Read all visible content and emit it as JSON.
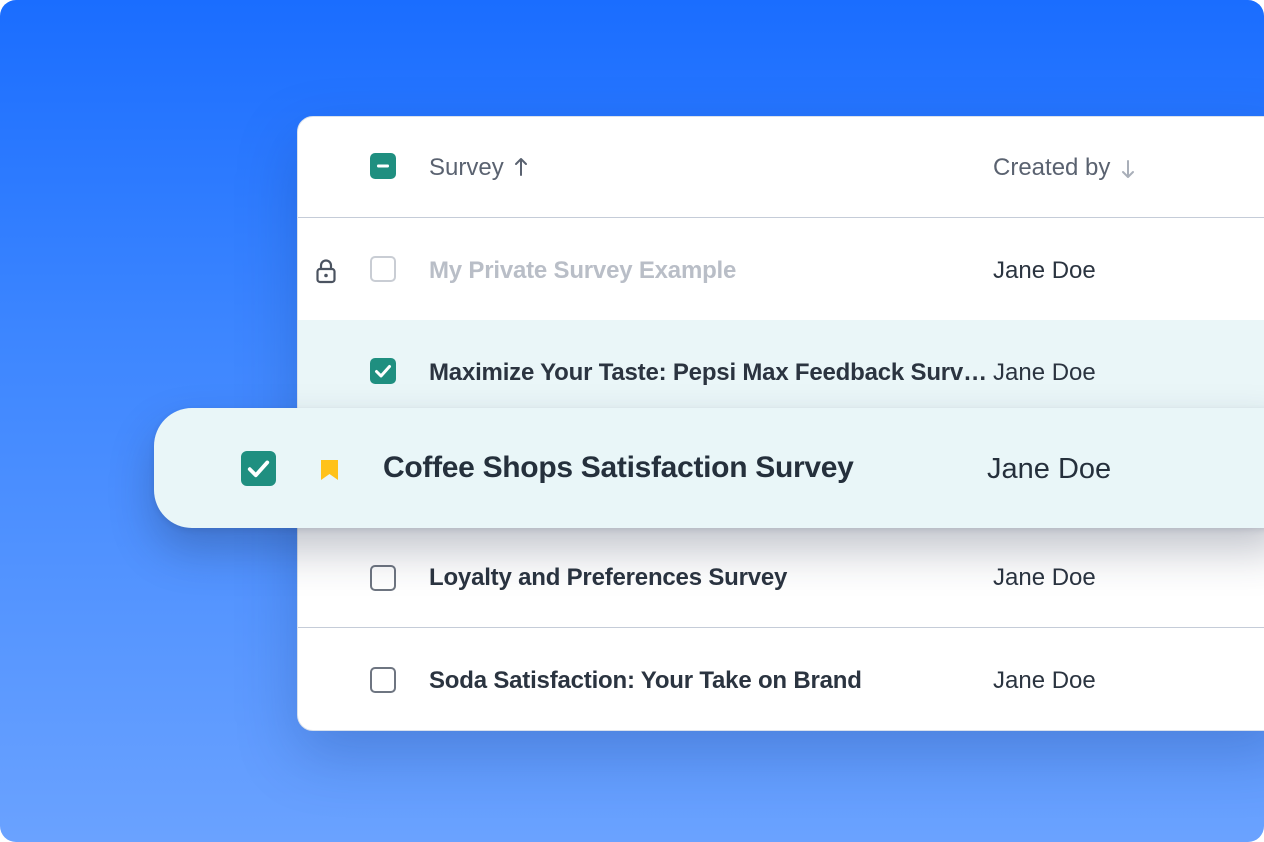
{
  "table": {
    "header": {
      "survey_label": "Survey",
      "survey_sort_icon": "arrow-up-icon",
      "created_by_label": "Created by",
      "created_by_sort_icon": "arrow-down-icon",
      "select_all_state": "indeterminate"
    },
    "rows": [
      {
        "survey": "My Private Survey Example",
        "created_by": "Jane Doe",
        "checked": false,
        "private": true,
        "icon": "lock-icon"
      },
      {
        "survey": "Maximize Your Taste: Pepsi Max Feedback Surv…",
        "created_by": "Jane Doe",
        "checked": true,
        "private": false
      },
      {
        "survey": "Coffee Shops Satisfaction Survey",
        "created_by": "Jane Doe",
        "checked": true,
        "bookmarked": true,
        "icon": "bookmark-icon",
        "highlighted": true
      },
      {
        "survey": "Loyalty and Preferences Survey",
        "created_by": "Jane Doe",
        "checked": false
      },
      {
        "survey": "Soda Satisfaction: Your Take on Brand",
        "created_by": "Jane Doe",
        "checked": false
      }
    ]
  },
  "colors": {
    "accent": "#1f8f80",
    "bookmark": "#ffc21a",
    "background_top": "#1a6dff",
    "background_bottom": "#6aa2ff",
    "highlight_row": "#e9f6f8"
  }
}
